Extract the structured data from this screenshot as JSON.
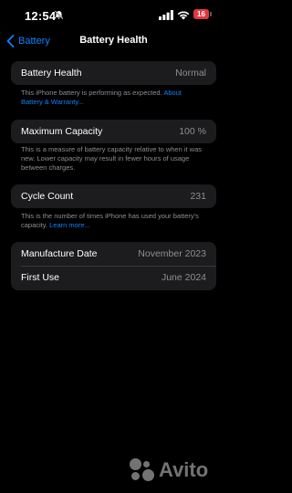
{
  "status_bar": {
    "time": "12:54",
    "icons": [
      "bell-slash-icon",
      "signal-icon",
      "wifi-icon"
    ],
    "battery_level": "16",
    "battery_color": "#e0383e"
  },
  "nav": {
    "back_label": "Battery",
    "title": "Battery Health"
  },
  "battery_health": {
    "label": "Battery Health",
    "value": "Normal",
    "note": "This iPhone battery is performing as expected.",
    "link": "About Battery & Warranty..."
  },
  "max_capacity": {
    "label": "Maximum Capacity",
    "value": "100 %",
    "note": "This is a measure of battery capacity relative to when it was new. Lower capacity may result in fewer hours of usage between charges."
  },
  "cycle_count": {
    "label": "Cycle Count",
    "value": "231",
    "note": "This is the number of times iPhone has used your battery's capacity.",
    "link": "Learn more..."
  },
  "dates": {
    "manufacture_label": "Manufacture Date",
    "manufacture_value": "November 2023",
    "first_use_label": "First Use",
    "first_use_value": "June 2024"
  },
  "watermark": {
    "brand": "Avito"
  },
  "colors": {
    "accent": "#0a84ff",
    "background": "#000000",
    "cell": "#1c1c1e",
    "secondary_text": "#8e8e93"
  }
}
